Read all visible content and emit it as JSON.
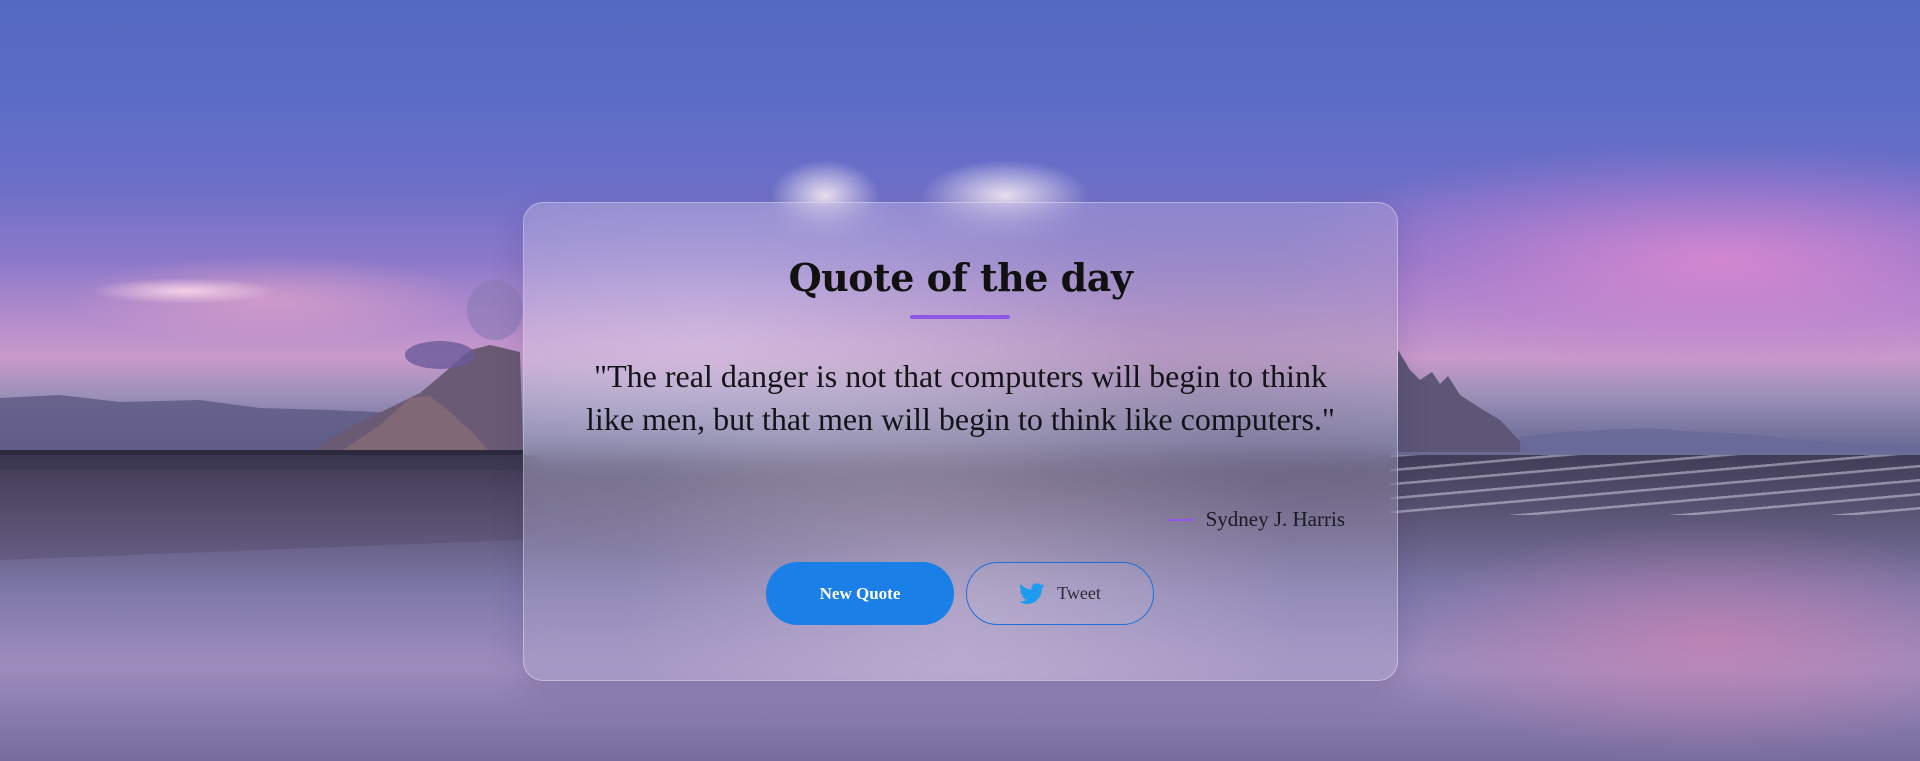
{
  "card": {
    "title": "Quote of the day",
    "quote": "\"The real danger is not that computers will begin to think like men, but that men will begin to think like computers.\"",
    "author": "Sydney J. Harris"
  },
  "buttons": {
    "new_quote_label": "New Quote",
    "tweet_label": "Tweet",
    "tweet_icon": "twitter-icon"
  },
  "colors": {
    "accent": "#8e57e8",
    "primary_button": "#1a7fe6",
    "tweet_border": "#1d6fd8",
    "twitter_blue": "#1d9bf0"
  }
}
